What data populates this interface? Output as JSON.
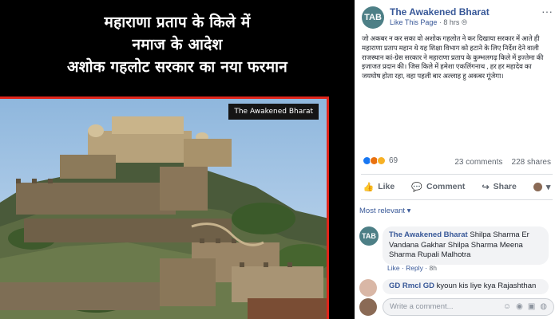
{
  "image": {
    "headline_lines": [
      "महाराणा प्रताप के किले में",
      "नमाज के आदेश",
      "अशोक गहलोट सरकार का नया फरमान"
    ],
    "watermark": "The Awakened Bharat"
  },
  "post": {
    "avatar_text": "TAB",
    "page_name": "The Awakened Bharat",
    "like_page": "Like This Page",
    "time": "8 hrs",
    "body": "जो अकबर न कर सका वो अशोक गहलोत ने कर दिखाया सरकार में आते ही महाराणा प्रताप महान थे यह शिक्षा विभाग को हटाने के लिए निर्देश देने वाली राजस्थान कां-ग्रेस सरकार ने महाराणा प्रताप के कुम्भलगढ़ किले में इज्तेमा की इजाजत प्रदान की। जिस किले में हमेशा एकलिंगनाथ , हर हर महादेव का जयघोष होता रहा, वहा पहली बार अल्लाह हु अकबर गूंजेगा।",
    "reaction_count": "69",
    "comments_count": "23 comments",
    "shares_count": "228 shares",
    "reaction_colors": [
      "#1877f2",
      "#f7b125",
      "#e9710f",
      "#f33e58"
    ]
  },
  "actions": {
    "like": "Like",
    "comment": "Comment",
    "share": "Share"
  },
  "most_relevant": "Most relevant",
  "comments": [
    {
      "name": "The Awakened Bharat",
      "text": "Shilpa Sharma Er Vandana Gakhar Shilpa Sharma Meena Sharma Rupali Malhotra",
      "like": "Like",
      "reply": "Reply",
      "time": "8h"
    },
    {
      "name": "GD Rmcl GD",
      "text": "kyoun kis liye kya Rajashthan"
    }
  ],
  "composer": {
    "placeholder": "Write a comment..."
  }
}
